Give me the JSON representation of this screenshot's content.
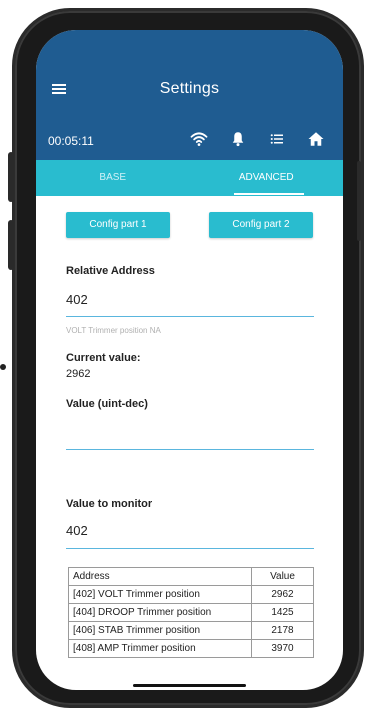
{
  "header": {
    "title": "Settings",
    "timer": "00:05:11",
    "icons": [
      "menu-icon",
      "wifi-icon",
      "bell-icon",
      "list-icon",
      "home-icon"
    ],
    "bg_color": "#1f5c91"
  },
  "tabs": {
    "items": [
      {
        "label": "BASE",
        "active": false
      },
      {
        "label": "ADVANCED",
        "active": true
      }
    ],
    "bg_color": "#29bccf"
  },
  "buttons": {
    "config1": "Config part 1",
    "config2": "Config part 2"
  },
  "relative_address": {
    "label": "Relative Address",
    "value": "402",
    "hint": "VOLT Trimmer position NA"
  },
  "current_value": {
    "label": "Current value:",
    "value": "2962"
  },
  "value_input": {
    "label": "Value (uint-dec)",
    "value": ""
  },
  "monitor": {
    "label": "Value to monitor",
    "value": "402"
  },
  "table": {
    "headers": [
      "Address",
      "Value"
    ],
    "rows": [
      {
        "address": "[402] VOLT Trimmer position",
        "value": "2962"
      },
      {
        "address": "[404] DROOP Trimmer position",
        "value": "1425"
      },
      {
        "address": "[406] STAB Trimmer position",
        "value": "2178"
      },
      {
        "address": "[408] AMP Trimmer position",
        "value": "3970"
      }
    ]
  }
}
